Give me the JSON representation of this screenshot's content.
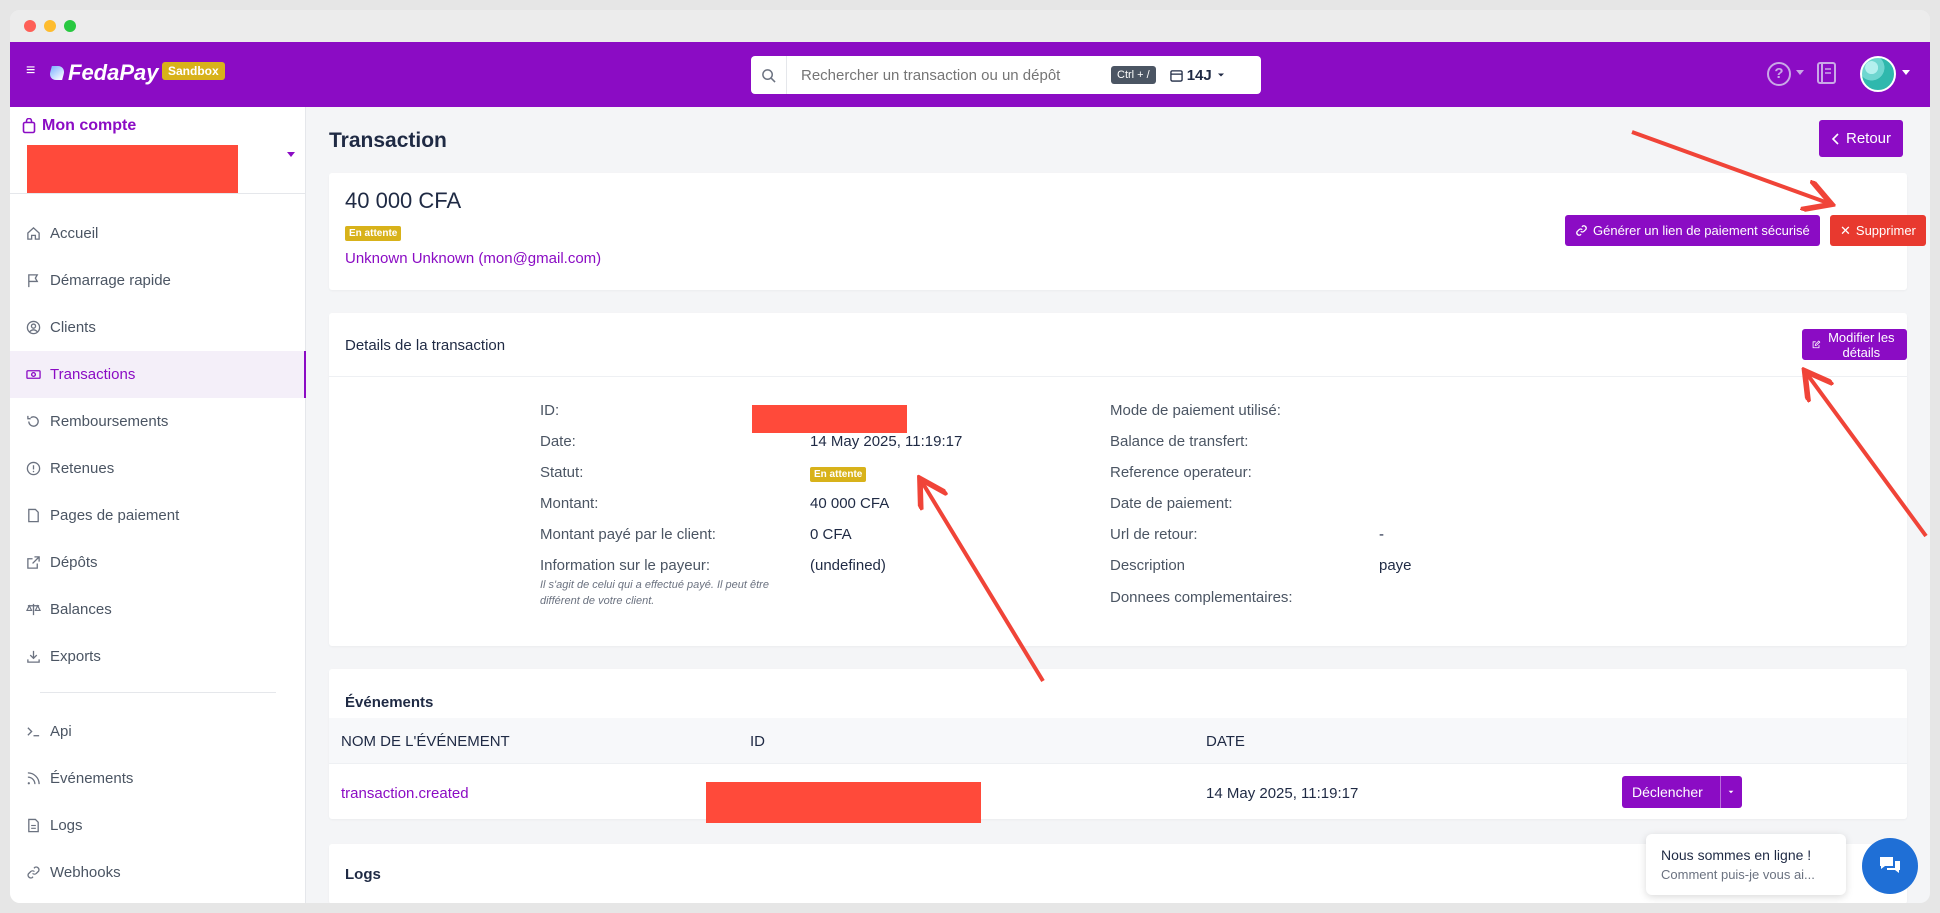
{
  "app": {
    "brand": "FedaPay",
    "env_badge": "Sandbox",
    "search_placeholder": "Rechercher un transaction ou un dépôt",
    "shortcut": "Ctrl + /",
    "period": "14J"
  },
  "sidebar": {
    "account_title": "Mon compte",
    "items": [
      {
        "label": "Accueil",
        "icon": "home-icon"
      },
      {
        "label": "Démarrage rapide",
        "icon": "flag-icon"
      },
      {
        "label": "Clients",
        "icon": "user-circle-icon"
      },
      {
        "label": "Transactions",
        "icon": "money-icon"
      },
      {
        "label": "Remboursements",
        "icon": "refund-icon"
      },
      {
        "label": "Retenues",
        "icon": "alert-icon"
      },
      {
        "label": "Pages de paiement",
        "icon": "page-icon"
      },
      {
        "label": "Dépôts",
        "icon": "external-icon"
      },
      {
        "label": "Balances",
        "icon": "scale-icon"
      },
      {
        "label": "Exports",
        "icon": "download-icon"
      }
    ],
    "items2": [
      {
        "label": "Api",
        "icon": "terminal-icon"
      },
      {
        "label": "Événements",
        "icon": "rss-icon"
      },
      {
        "label": "Logs",
        "icon": "file-icon"
      },
      {
        "label": "Webhooks",
        "icon": "link-icon"
      }
    ]
  },
  "page": {
    "title": "Transaction",
    "back": "Retour"
  },
  "summary": {
    "amount": "40 000 CFA",
    "status": "En attente",
    "customer": "Unknown Unknown (mon@gmail.com)",
    "generate_link": "Générer un lien de paiement sécurisé",
    "delete": "Supprimer"
  },
  "details": {
    "title": "Details de la transaction",
    "edit": "Modifier les détails",
    "left": {
      "id_label": "ID:",
      "date_label": "Date:",
      "date_value": "14 May 2025, 11:19:17",
      "status_label": "Statut:",
      "status_value": "En attente",
      "amount_label": "Montant:",
      "amount_value": "40 000 CFA",
      "paid_label": "Montant payé par le client:",
      "paid_value": "0 CFA",
      "payer_label": "Information sur le payeur:",
      "payer_hint": "Il s'agit de celui qui a effectué payé. Il peut être différent de votre client.",
      "payer_value": "(undefined)"
    },
    "right": {
      "mode_label": "Mode de paiement utilisé:",
      "balance_label": "Balance de transfert:",
      "ref_label": "Reference operateur:",
      "paydate_label": "Date de paiement:",
      "url_label": "Url de retour:",
      "url_value": "-",
      "desc_label": "Description",
      "desc_value": "paye",
      "extra_label": "Donnees complementaires:"
    }
  },
  "events": {
    "title": "Événements",
    "columns": [
      "NOM DE L'ÉVÉNEMENT",
      "ID",
      "DATE"
    ],
    "rows": [
      {
        "name": "transaction.created",
        "date": "14 May 2025, 11:19:17"
      }
    ],
    "trigger": "Déclencher"
  },
  "logs": {
    "title": "Logs"
  },
  "chat": {
    "line1": "Nous sommes en ligne !",
    "line2": "Comment puis-je vous ai..."
  },
  "colors": {
    "brand": "#8b0cc4",
    "pending": "#d8b21a",
    "danger": "#e8392f",
    "annotation": "#f04438"
  }
}
